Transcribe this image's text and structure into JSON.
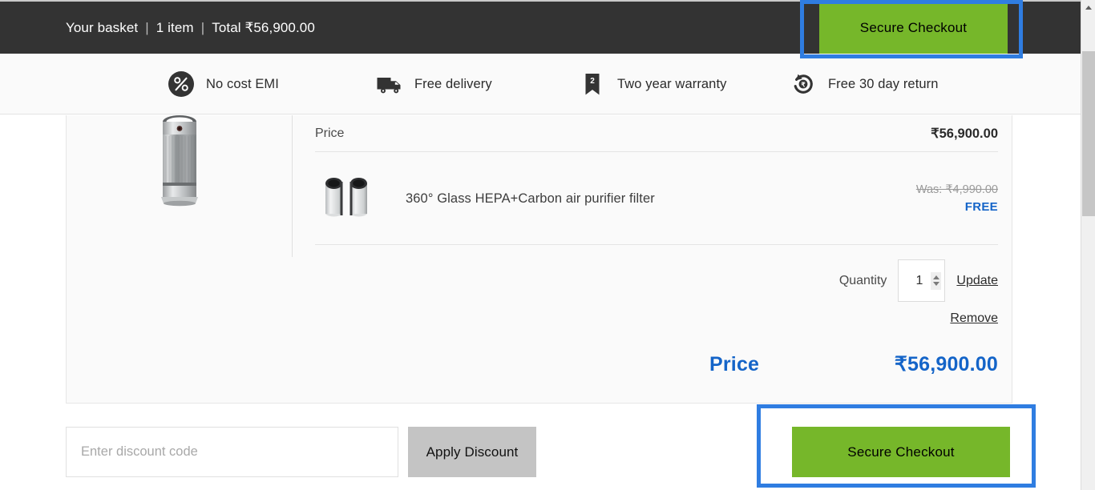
{
  "basket": {
    "title": "Your basket",
    "separator": "|",
    "item_count": "1 item",
    "total": "Total ₹56,900.00",
    "checkout_label": "Secure Checkout"
  },
  "features": [
    {
      "icon": "percent-circle-icon",
      "label": "No cost EMI"
    },
    {
      "icon": "delivery-truck-icon",
      "label": "Free delivery"
    },
    {
      "icon": "warranty-ribbon-icon",
      "label": "Two year warranty"
    },
    {
      "icon": "rupee-refund-icon",
      "label": "Free 30 day return"
    }
  ],
  "cart": {
    "product_image_alt": "air-purifier-product-image",
    "price_row": {
      "label": "Price",
      "value": "₹56,900.00"
    },
    "filter_item": {
      "image_alt": "hepa-carbon-filter-image",
      "name": "360° Glass HEPA+Carbon air purifier filter",
      "was_price": "Was: ₹4,990.00",
      "current_price": "FREE"
    },
    "quantity": {
      "label": "Quantity",
      "value": "1",
      "update_label": "Update"
    },
    "remove_label": "Remove",
    "total_row": {
      "label": "Price",
      "value": "₹56,900.00"
    }
  },
  "actions": {
    "discount_placeholder": "Enter discount code",
    "discount_value": "",
    "apply_label": "Apply Discount",
    "checkout_label": "Secure Checkout"
  },
  "colors": {
    "header_bg": "#333333",
    "checkout_green": "#76b72a",
    "accent_blue": "#1464c8",
    "annotation_blue": "#2f7de1",
    "apply_grey": "#c4c4c4"
  }
}
